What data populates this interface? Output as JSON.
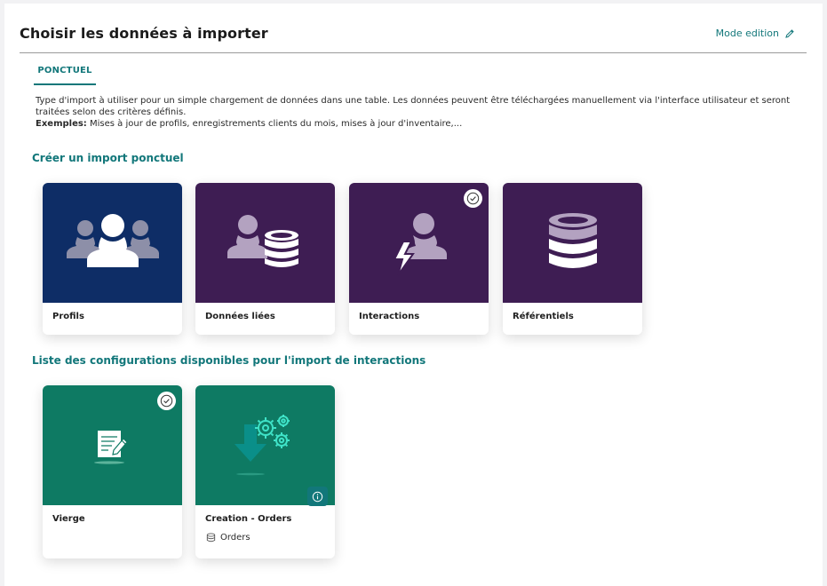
{
  "header": {
    "title": "Choisir les données à importer",
    "mode_edition": "Mode edition"
  },
  "tabs": [
    {
      "label": "PONCTUEL"
    }
  ],
  "description": {
    "line": "Type d'import à utiliser pour un simple chargement de données dans une table. Les données peuvent être téléchargées manuellement via l'interface utilisateur et seront traitées selon des critères définis.",
    "examples_label": "Exemples:",
    "examples_text": " Mises à jour de profils, enregistrements clients du mois, mises à jour d'inventaire,..."
  },
  "section_import": {
    "title": "Créer un import ponctuel",
    "cards": [
      {
        "label": "Profils",
        "icon": "group-users-icon",
        "color": "#0e2d66",
        "selected": false
      },
      {
        "label": "Données liées",
        "icon": "user-database-icon",
        "color": "#3e1d53",
        "selected": false
      },
      {
        "label": "Interactions",
        "icon": "user-lightning-icon",
        "color": "#3e1d53",
        "selected": true
      },
      {
        "label": "Référentiels",
        "icon": "database-icon",
        "color": "#3e1d53",
        "selected": false
      }
    ]
  },
  "section_configs": {
    "title": "Liste des configurations disponibles pour l'import de interactions",
    "cards": [
      {
        "label": "Vierge",
        "icon": "document-edit-icon",
        "color": "#0e7a63",
        "selected": true
      },
      {
        "label": "Creation - Orders",
        "icon": "download-gears-icon",
        "color": "#0e7a63",
        "selected": false,
        "sub": "Orders"
      }
    ]
  }
}
